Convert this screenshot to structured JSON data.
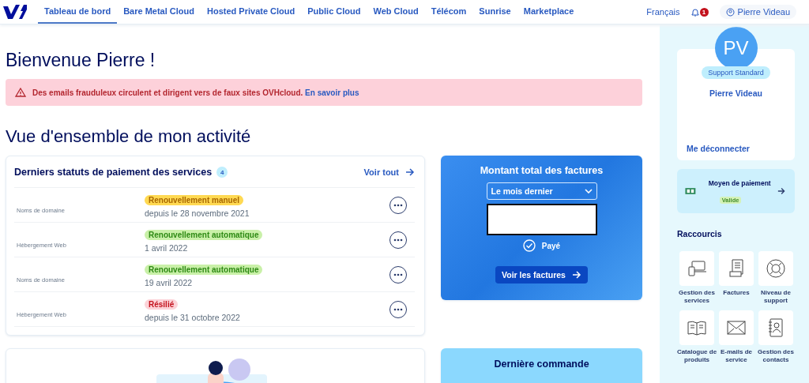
{
  "nav": {
    "tabs": [
      {
        "label": "Tableau de bord",
        "selected": true
      },
      {
        "label": "Bare Metal Cloud",
        "selected": false
      },
      {
        "label": "Hosted Private Cloud",
        "selected": false
      },
      {
        "label": "Public Cloud",
        "selected": false
      },
      {
        "label": "Web Cloud",
        "selected": false
      },
      {
        "label": "Télécom",
        "selected": false
      },
      {
        "label": "Sunrise",
        "selected": false
      },
      {
        "label": "Marketplace",
        "selected": false
      }
    ],
    "language": "Français",
    "notifications": "1",
    "user": "Pierre Videau"
  },
  "welcome": "Bienvenue Pierre !",
  "alert": {
    "text": "Des emails frauduleux circulent et dirigent vers de faux sites OVHcloud.",
    "link": "En savoir plus"
  },
  "overview_title": "Vue d'ensemble de mon activité",
  "payments": {
    "title": "Derniers statuts de paiement des services",
    "count": "4",
    "link": "Voir tout",
    "rows": [
      {
        "type": "Noms de domaine",
        "status": "Renouvellement manuel",
        "kind": "manual",
        "date": "depuis le 28 novembre 2021"
      },
      {
        "type": "Hébergement Web",
        "status": "Renouvellement automatique",
        "kind": "auto",
        "date": "1 avril 2022"
      },
      {
        "type": "Noms de domaine",
        "status": "Renouvellement automatique",
        "kind": "auto",
        "date": "19 avril 2022"
      },
      {
        "type": "Hébergement Web",
        "status": "Résilié",
        "kind": "cancelled",
        "date": "depuis le 31 octobre 2022"
      }
    ]
  },
  "invoices": {
    "title": "Montant total des factures",
    "period": "Le mois dernier",
    "status": "Payé",
    "button": "Voir les factures"
  },
  "last_order": {
    "title": "Dernière commande"
  },
  "profile": {
    "initials": "PV",
    "support": "Support Standard",
    "name": "Pierre Videau",
    "logout": "Me déconnecter"
  },
  "payment_method": {
    "title": "Moyen de paiement",
    "status": "Valide"
  },
  "shortcuts": {
    "title": "Raccourcis",
    "items": [
      {
        "label": "Gestion des services",
        "kind": "devices"
      },
      {
        "label": "Factures",
        "kind": "invoice"
      },
      {
        "label": "Niveau de support",
        "kind": "lifebuoy"
      },
      {
        "label": "Catalogue de produits",
        "kind": "book"
      },
      {
        "label": "E-mails de service",
        "kind": "mail"
      },
      {
        "label": "Gestion des contacts",
        "kind": "contacts"
      }
    ]
  }
}
